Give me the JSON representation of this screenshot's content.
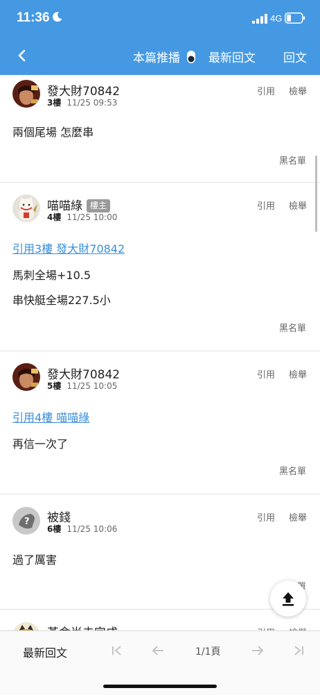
{
  "status_bar": {
    "time": "11:36",
    "network": "4G"
  },
  "navbar": {
    "recommend_label": "本篇推播",
    "latest_label": "最新回文",
    "reply_label": "回文"
  },
  "posts": [
    {
      "author": "發大財70842",
      "floor": "3樓",
      "time": "11/25 09:53",
      "quote_label": "引用",
      "report_label": "檢舉",
      "lines": [
        "兩個尾場 怎麼串"
      ],
      "blacklist_label": "黑名單"
    },
    {
      "author": "喵喵綠",
      "badge": "樓主",
      "floor": "4樓",
      "time": "11/25 10:00",
      "quote_label": "引用",
      "report_label": "檢舉",
      "quote_link": "引用3樓 發大財70842",
      "lines": [
        "馬刺全場+10.5",
        "串快艇全場227.5小"
      ],
      "blacklist_label": "黑名單"
    },
    {
      "author": "發大財70842",
      "floor": "5樓",
      "time": "11/25 10:05",
      "quote_label": "引用",
      "report_label": "檢舉",
      "quote_link": "引用4樓 喵喵綠",
      "lines": [
        "再信一次了"
      ],
      "blacklist_label": "黑名單"
    },
    {
      "author": "被錢",
      "floor": "6樓",
      "time": "11/25 10:06",
      "quote_label": "引用",
      "report_label": "檢舉",
      "lines": [
        "過了厲害"
      ],
      "blacklist_label": "黑名單"
    },
    {
      "author": "革命尚未完成",
      "quote_label": "引用",
      "report_label": "檢舉"
    }
  ],
  "bottom_bar": {
    "latest_label": "最新回文",
    "page_label": "1/1頁"
  },
  "icons": [
    "moon-icon",
    "signal-icon",
    "battery-icon",
    "back-icon",
    "toggle-icon",
    "first-page-icon",
    "prev-page-icon",
    "next-page-icon",
    "last-page-icon",
    "arrow-up-icon"
  ],
  "colors": {
    "header": "#4599e3",
    "link": "#3b8ed6",
    "badge": "#9a9a9a"
  }
}
